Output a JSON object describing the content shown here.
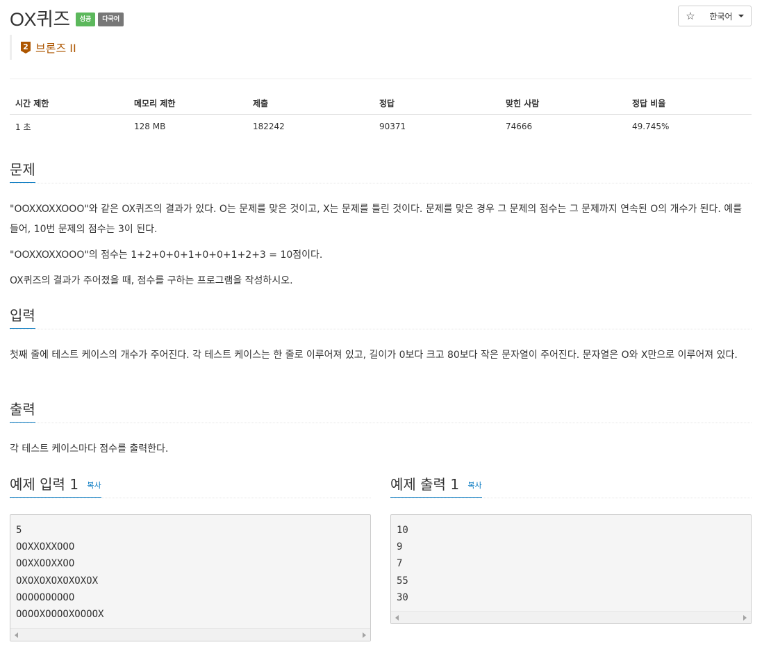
{
  "header": {
    "title": "OX퀴즈",
    "badges": [
      "성공",
      "다국어"
    ],
    "tier_number": "2",
    "tier_label": "브론즈 II",
    "star_icon": "☆",
    "language": "한국어"
  },
  "info_table": {
    "headers": [
      "시간 제한",
      "메모리 제한",
      "제출",
      "정답",
      "맞힌 사람",
      "정답 비율"
    ],
    "row": [
      "1 초",
      "128 MB",
      "182242",
      "90371",
      "74666",
      "49.745%"
    ]
  },
  "problem": {
    "heading": "문제",
    "paragraphs": [
      "\"OOXXOXXOOO\"와 같은 OX퀴즈의 결과가 있다. O는 문제를 맞은 것이고, X는 문제를 틀린 것이다. 문제를 맞은 경우 그 문제의 점수는 그 문제까지 연속된 O의 개수가 된다. 예를 들어, 10번 문제의 점수는 3이 된다.",
      "\"OOXXOXXOOO\"의 점수는 1+2+0+0+1+0+0+1+2+3 = 10점이다.",
      "OX퀴즈의 결과가 주어졌을 때, 점수를 구하는 프로그램을 작성하시오."
    ]
  },
  "input": {
    "heading": "입력",
    "text": "첫째 줄에 테스트 케이스의 개수가 주어진다. 각 테스트 케이스는 한 줄로 이루어져 있고, 길이가 0보다 크고 80보다 작은 문자열이 주어진다. 문자열은 O와 X만으로 이루어져 있다."
  },
  "output": {
    "heading": "출력",
    "text": "각 테스트 케이스마다 점수를 출력한다."
  },
  "sample_input": {
    "heading": "예제 입력 1",
    "copy": "복사",
    "lines": [
      "5",
      "OOXXOXXOOO",
      "OOXXOOXXOO",
      "OXOXOXOXOXOXOX",
      "OOOOOOOOOO",
      "OOOOXOOOOXOOOOX"
    ]
  },
  "sample_output": {
    "heading": "예제 출력 1",
    "copy": "복사",
    "lines": [
      "10",
      "9",
      "7",
      "55",
      "30"
    ]
  },
  "colors": {
    "tier": "#ad5600",
    "success_badge": "#5cb85c",
    "multi_badge": "#777777",
    "accent": "#0076c0"
  }
}
